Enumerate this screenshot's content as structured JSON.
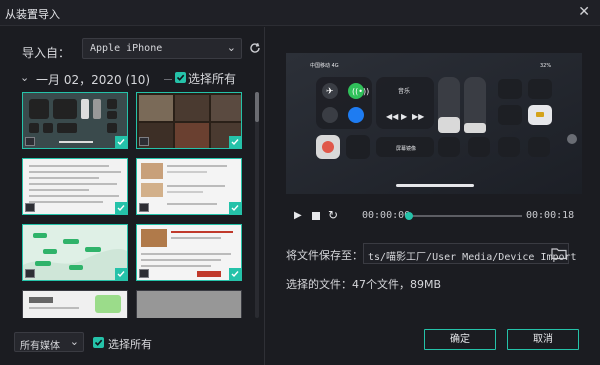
{
  "window": {
    "title": "从装置导入",
    "close_icon": "close-icon"
  },
  "left": {
    "import_label": "导入自：",
    "device": {
      "value": "Apple iPhone"
    },
    "date_group": {
      "text": "一月 02，2020 (10)",
      "select_all": "选择所有"
    },
    "thumbnails": [
      {
        "type": "image",
        "content": "control-center",
        "checked": true
      },
      {
        "type": "image",
        "content": "photo-collage",
        "checked": true
      },
      {
        "type": "image",
        "content": "document-text",
        "checked": true
      },
      {
        "type": "image",
        "content": "chat-list",
        "checked": true
      },
      {
        "type": "image",
        "content": "map",
        "checked": true
      },
      {
        "type": "image",
        "content": "document-with-photo",
        "checked": true
      },
      {
        "type": "image",
        "content": "app-screen",
        "checked": false
      },
      {
        "type": "image",
        "content": "photo-gray",
        "checked": false
      }
    ],
    "media_filter": {
      "value": "所有媒体"
    },
    "select_all_bottom": "选择所有"
  },
  "right": {
    "player": {
      "current_time": "00:00:00",
      "end_time": "00:00:18",
      "progress": 0.0
    },
    "save_label": "将文件保存至：",
    "save_path": "ts/喵影工厂/User Media/Device Import",
    "selected_files": "选择的文件：47个文件，89MB",
    "preview_status": {
      "carrier": "中国移动 4G",
      "battery": "32%",
      "music_label": "音乐",
      "mirror_label": "屏幕镜像"
    }
  },
  "buttons": {
    "ok": "确定",
    "cancel": "取消"
  },
  "colors": {
    "accent": "#25c2a9",
    "background": "#1b1c21"
  }
}
